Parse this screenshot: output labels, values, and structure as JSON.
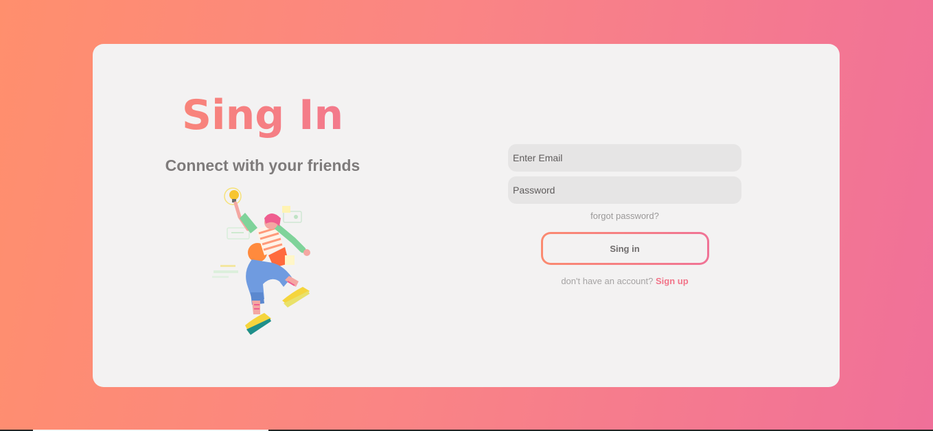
{
  "login": {
    "title": "Sing In",
    "subtitle": "Connect with your friends",
    "email_placeholder": "Enter Email",
    "password_placeholder": "Password",
    "forgot_label": "forgot password?",
    "submit_label": "Sing in",
    "signup_prompt": "don't have an account?",
    "signup_label": "Sign up"
  },
  "colors": {
    "gradient_start": "#ff8f6d",
    "gradient_end": "#f07099",
    "card_bg": "#f3f2f2",
    "input_bg": "#e6e5e5",
    "accent": "#f27489"
  },
  "illustration": {
    "icon": "person-jumping-with-lightbulb-illustration"
  }
}
